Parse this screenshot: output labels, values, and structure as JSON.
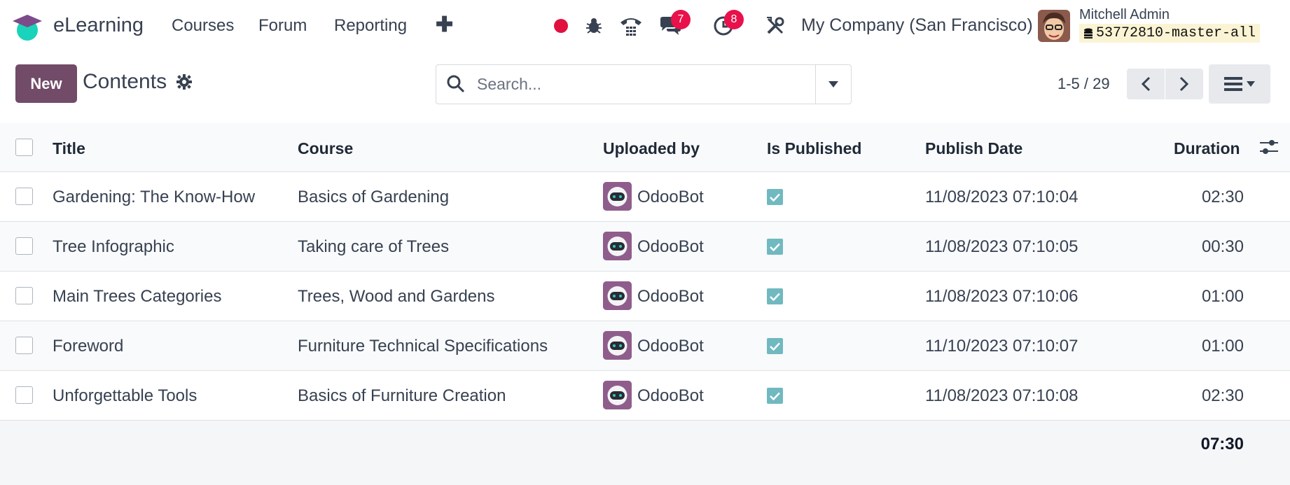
{
  "app": {
    "name": "eLearning"
  },
  "menu": [
    "Courses",
    "Forum",
    "Reporting"
  ],
  "systray": {
    "messages_count": "7",
    "activities_count": "8"
  },
  "company": "My Company (San Francisco)",
  "user": {
    "name": "Mitchell Admin",
    "db": "53772810-master-all"
  },
  "control": {
    "new_label": "New",
    "title": "Contents",
    "search_placeholder": "Search...",
    "pager": "1-5 / 29"
  },
  "table": {
    "headers": {
      "title": "Title",
      "course": "Course",
      "uploaded_by": "Uploaded by",
      "is_published": "Is Published",
      "publish_date": "Publish Date",
      "duration": "Duration"
    },
    "rows": [
      {
        "title": "Gardening: The Know-How",
        "course": "Basics of Gardening",
        "uploaded_by": "OdooBot",
        "published": true,
        "publish_date": "11/08/2023 07:10:04",
        "duration": "02:30"
      },
      {
        "title": "Tree Infographic",
        "course": "Taking care of Trees",
        "uploaded_by": "OdooBot",
        "published": true,
        "publish_date": "11/08/2023 07:10:05",
        "duration": "00:30"
      },
      {
        "title": "Main Trees Categories",
        "course": "Trees, Wood and Gardens",
        "uploaded_by": "OdooBot",
        "published": true,
        "publish_date": "11/08/2023 07:10:06",
        "duration": "01:00"
      },
      {
        "title": "Foreword",
        "course": "Furniture Technical Specifications",
        "uploaded_by": "OdooBot",
        "published": true,
        "publish_date": "11/10/2023 07:10:07",
        "duration": "01:00"
      },
      {
        "title": "Unforgettable Tools",
        "course": "Basics of Furniture Creation",
        "uploaded_by": "OdooBot",
        "published": true,
        "publish_date": "11/08/2023 07:10:08",
        "duration": "02:30"
      }
    ],
    "total_duration": "07:30"
  },
  "colors": {
    "brand": "#714b67",
    "checkbox_checked": "#71b9c0",
    "badge": "#e8114b",
    "record_dot": "#e0103f"
  }
}
